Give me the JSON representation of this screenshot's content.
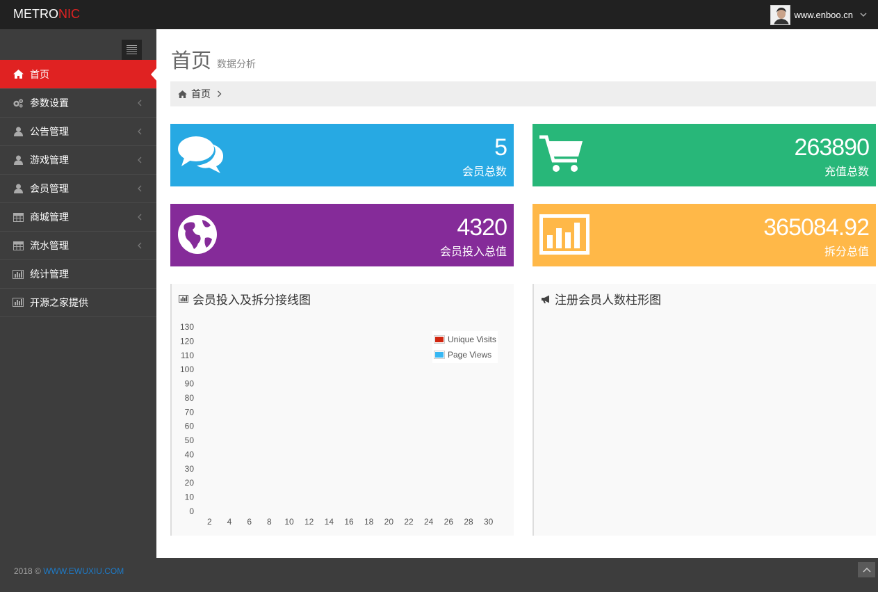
{
  "brand": {
    "part1": "METRO",
    "part2": "NIC",
    "accent": "#e02222"
  },
  "user": {
    "name": "www.enboo.cn"
  },
  "sidebar": {
    "items": [
      {
        "label": "首页",
        "icon": "home-icon",
        "active": true
      },
      {
        "label": "参数设置",
        "icon": "gears-icon"
      },
      {
        "label": "公告管理",
        "icon": "user-icon"
      },
      {
        "label": "游戏管理",
        "icon": "user-icon"
      },
      {
        "label": "会员管理",
        "icon": "user-icon"
      },
      {
        "label": "商城管理",
        "icon": "table-icon"
      },
      {
        "label": "流水管理",
        "icon": "table-icon"
      },
      {
        "label": "统计管理",
        "icon": "bar-chart-icon"
      },
      {
        "label": "开源之家提供",
        "icon": "bar-chart-icon"
      }
    ]
  },
  "page": {
    "title": "首页",
    "subtitle": "数据分析"
  },
  "breadcrumb": {
    "home": "首页"
  },
  "stats": [
    {
      "value": "5",
      "label": "会员总数",
      "icon": "comments-icon",
      "color": "#27a9e3"
    },
    {
      "value": "263890",
      "label": "充值总数",
      "icon": "shopping-cart-icon",
      "color": "#28b779"
    },
    {
      "value": "4320",
      "label": "会员投入总值",
      "icon": "globe-icon",
      "color": "#852b99"
    },
    {
      "value": "365084.92",
      "label": "拆分总值",
      "icon": "bar-chart-icon",
      "color": "#ffb848"
    }
  ],
  "portlets": {
    "line": {
      "title": "会员投入及拆分接线图",
      "icon": "bar-chart-icon"
    },
    "bar": {
      "title": "注册会员人数柱形图",
      "icon": "bullhorn-icon"
    }
  },
  "chart_data": {
    "type": "line",
    "x_ticks": [
      2,
      4,
      6,
      8,
      10,
      12,
      14,
      16,
      18,
      20,
      22,
      24,
      26,
      28,
      30
    ],
    "y_ticks": [
      0,
      10,
      20,
      30,
      40,
      50,
      60,
      70,
      80,
      90,
      100,
      110,
      120,
      130
    ],
    "xlim": [
      1,
      31
    ],
    "ylim": [
      0,
      130
    ],
    "series": [
      {
        "name": "Unique Visits",
        "color": "#d12610",
        "values": []
      },
      {
        "name": "Page Views",
        "color": "#37b7f3",
        "values": []
      }
    ],
    "legend": "top-right",
    "grid": false
  },
  "footer": {
    "copyright": "2018 © ",
    "link": "WWW.EWUXIU.COM"
  }
}
